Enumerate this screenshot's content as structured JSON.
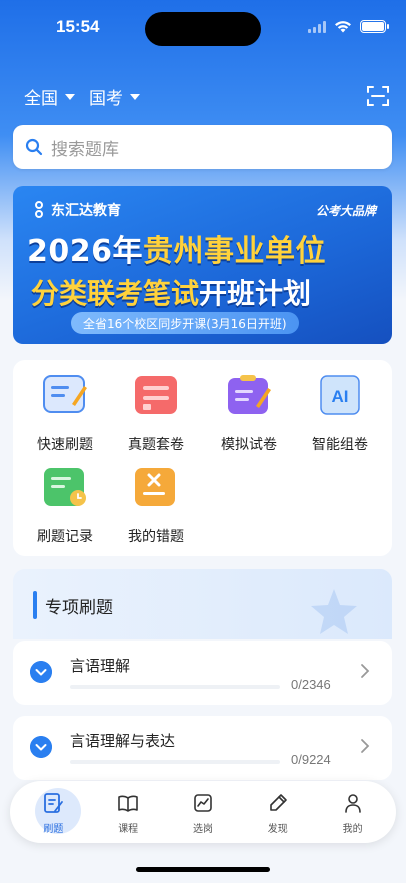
{
  "status_bar": {
    "time": "15:54"
  },
  "filters": {
    "region": "全国",
    "exam": "国考"
  },
  "search": {
    "placeholder": "搜索题库"
  },
  "banner": {
    "logo": "东汇达教育",
    "tag": "公考大品牌",
    "line1_prefix": "2026年",
    "line1_highlight": "贵州事业单位",
    "line2_highlight": "分类联考笔试",
    "line2_suffix": "开班计划",
    "pill": "全省16个校区同步开课(3月16日开班)"
  },
  "quick_grid": [
    {
      "label": "快速刷题",
      "icon": "quick-practice-icon"
    },
    {
      "label": "真题套卷",
      "icon": "past-papers-icon"
    },
    {
      "label": "模拟试卷",
      "icon": "mock-exam-icon"
    },
    {
      "label": "智能组卷",
      "icon": "ai-paper-icon",
      "icon_text": "AI"
    },
    {
      "label": "刷题记录",
      "icon": "practice-record-icon"
    },
    {
      "label": "我的错题",
      "icon": "wrong-questions-icon"
    }
  ],
  "special": {
    "title": "专项刷题"
  },
  "topics": [
    {
      "title": "言语理解",
      "count": "0/2346",
      "progress": 0
    },
    {
      "title": "言语理解与表达",
      "count": "0/9224",
      "progress": 0
    }
  ],
  "tabs": [
    {
      "label": "刷题",
      "active": true
    },
    {
      "label": "课程",
      "active": false
    },
    {
      "label": "选岗",
      "active": false
    },
    {
      "label": "发现",
      "active": false
    },
    {
      "label": "我的",
      "active": false
    }
  ],
  "colors": {
    "primary": "#2a7ff0",
    "accent": "#ffd23c"
  }
}
